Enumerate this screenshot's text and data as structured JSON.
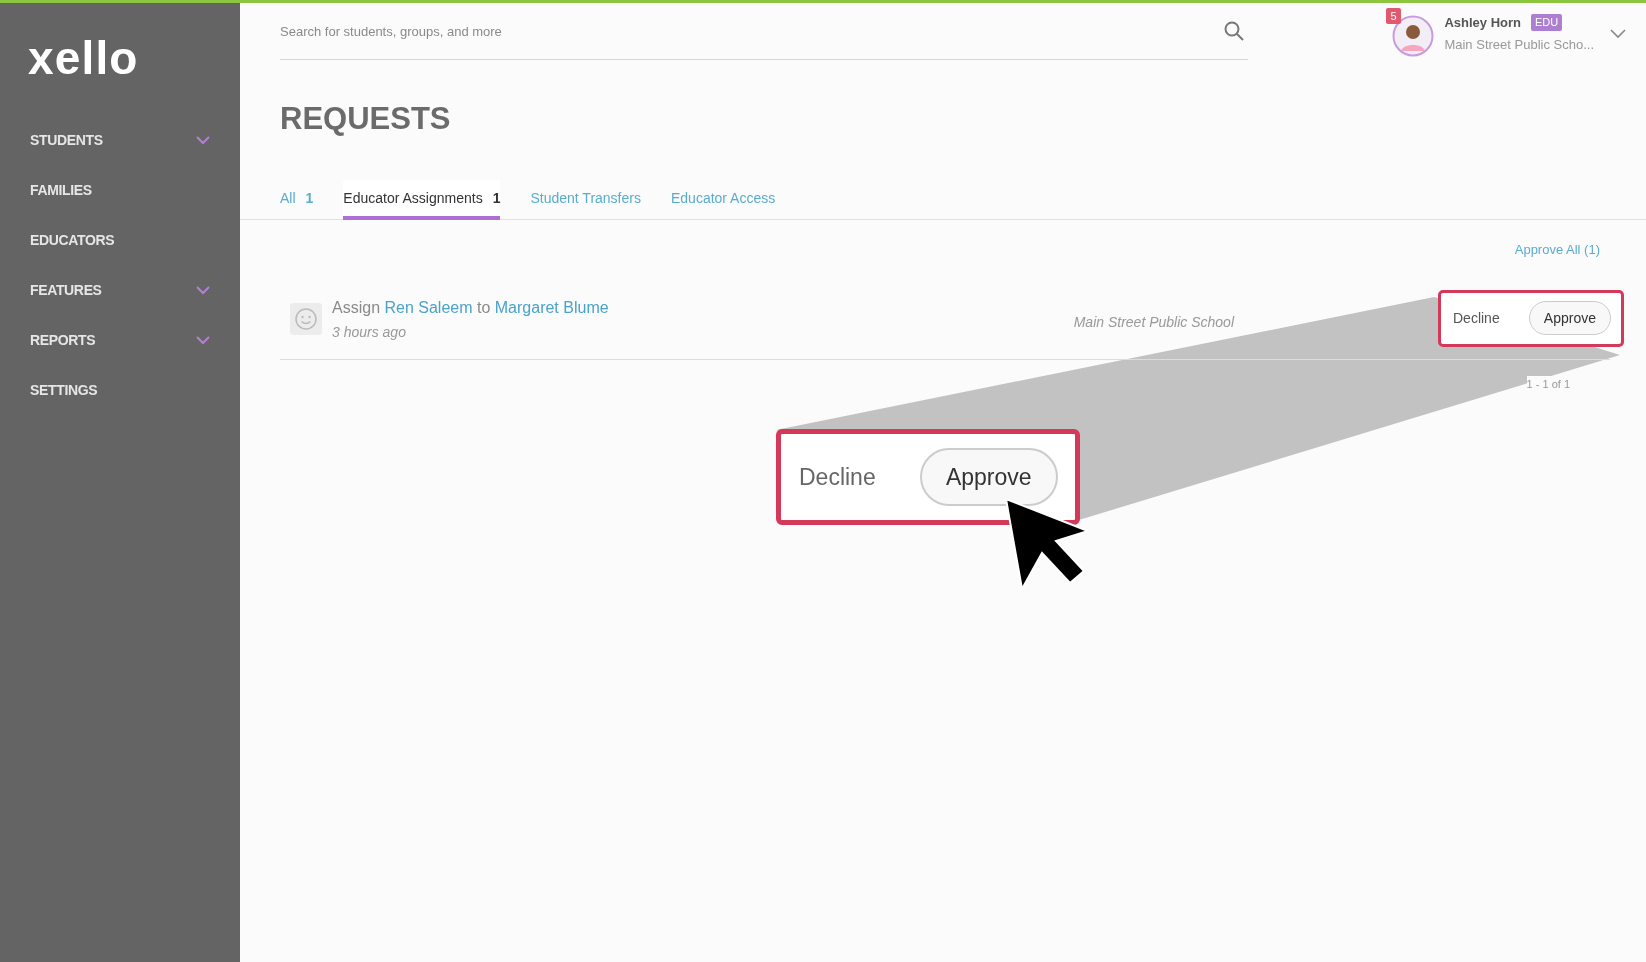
{
  "sidebar": {
    "logo": "xello",
    "items": [
      {
        "label": "STUDENTS",
        "expandable": true
      },
      {
        "label": "FAMILIES",
        "expandable": false
      },
      {
        "label": "EDUCATORS",
        "expandable": false
      },
      {
        "label": "FEATURES",
        "expandable": true
      },
      {
        "label": "REPORTS",
        "expandable": true
      },
      {
        "label": "SETTINGS",
        "expandable": false
      }
    ]
  },
  "search": {
    "placeholder": "Search for students, groups, and more"
  },
  "user": {
    "notifications": "5",
    "name": "Ashley Horn",
    "role": "EDU",
    "school": "Main Street Public Scho..."
  },
  "page_title": "REQUESTS",
  "tabs": [
    {
      "label": "All",
      "count": "1",
      "selected": false
    },
    {
      "label": "Educator Assignments",
      "count": "1",
      "selected": true
    },
    {
      "label": "Student Transfers",
      "selected": false
    },
    {
      "label": "Educator Access",
      "selected": false
    }
  ],
  "approve_all": "Approve All (1)",
  "requests": [
    {
      "parts": [
        {
          "kind": "text",
          "text": "Assign"
        },
        {
          "kind": "link",
          "text": "Ren Saleem"
        },
        {
          "kind": "text",
          "text": "to"
        },
        {
          "kind": "link",
          "text": "Margaret Blume"
        }
      ],
      "time": "3 hours ago",
      "school": "Main Street Public School",
      "decline": "Decline",
      "approve": "Approve"
    }
  ],
  "pagination": "1 - 1 of 1",
  "callout": {
    "decline": "Decline",
    "approve": "Approve"
  }
}
